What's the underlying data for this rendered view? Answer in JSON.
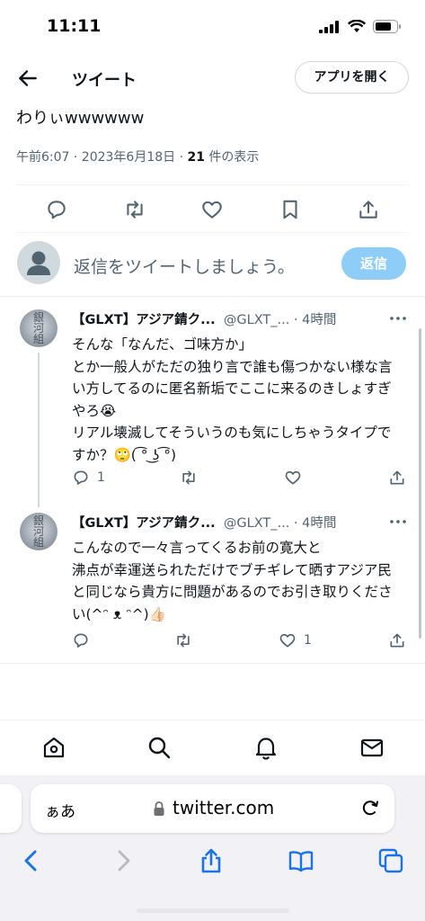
{
  "status_bar": {
    "time": "11:11"
  },
  "header": {
    "title": "ツイート",
    "open_app_label": "アプリを開く"
  },
  "tweet": {
    "partial_text": "わりぃwwwwww",
    "meta_time": "午前6:07 · 2023年6月18日 · ",
    "view_count": "21",
    "view_label": " 件の表示"
  },
  "compose": {
    "placeholder": "返信をツイートしましょう。",
    "button_label": "返信"
  },
  "replies": [
    {
      "avatar_text": "銀\n河\n組",
      "name": "【GLXT】アジア錆ク...",
      "handle": "@GLXT_...",
      "time": " · 4時間",
      "body": "そんな「なんだ、ゴ味方か」\nとか一般人がただの独り言で誰も傷つかない様な言い方してるのに匿名新垢でここに来るのきしょすぎやろ😭\nリアル壊滅してそういうのも気にしちゃうタイプですか？🙄( ͡° ͜ʖ ͡°)",
      "reply_count": "1",
      "retweet_count": "",
      "like_count": ""
    },
    {
      "avatar_text": "銀\n河\n組",
      "name": "【GLXT】アジア錆ク...",
      "handle": "@GLXT_...",
      "time": " · 4時間",
      "body": "こんなので一々言ってくるお前の寛大と\n沸点が幸運送られただけでブチギレて晒すアジア民と同じなら貴方に問題があるのでお引き取りください(^ᵔ ᴥ ᵔ^)👍🏻",
      "reply_count": "",
      "retweet_count": "",
      "like_count": "1"
    }
  ],
  "safari": {
    "aa_label": "ぁあ",
    "url": "twitter.com"
  },
  "colors": {
    "accent": "#1d9bf0",
    "reply_button": "#8ecdf8",
    "muted": "#536471"
  }
}
